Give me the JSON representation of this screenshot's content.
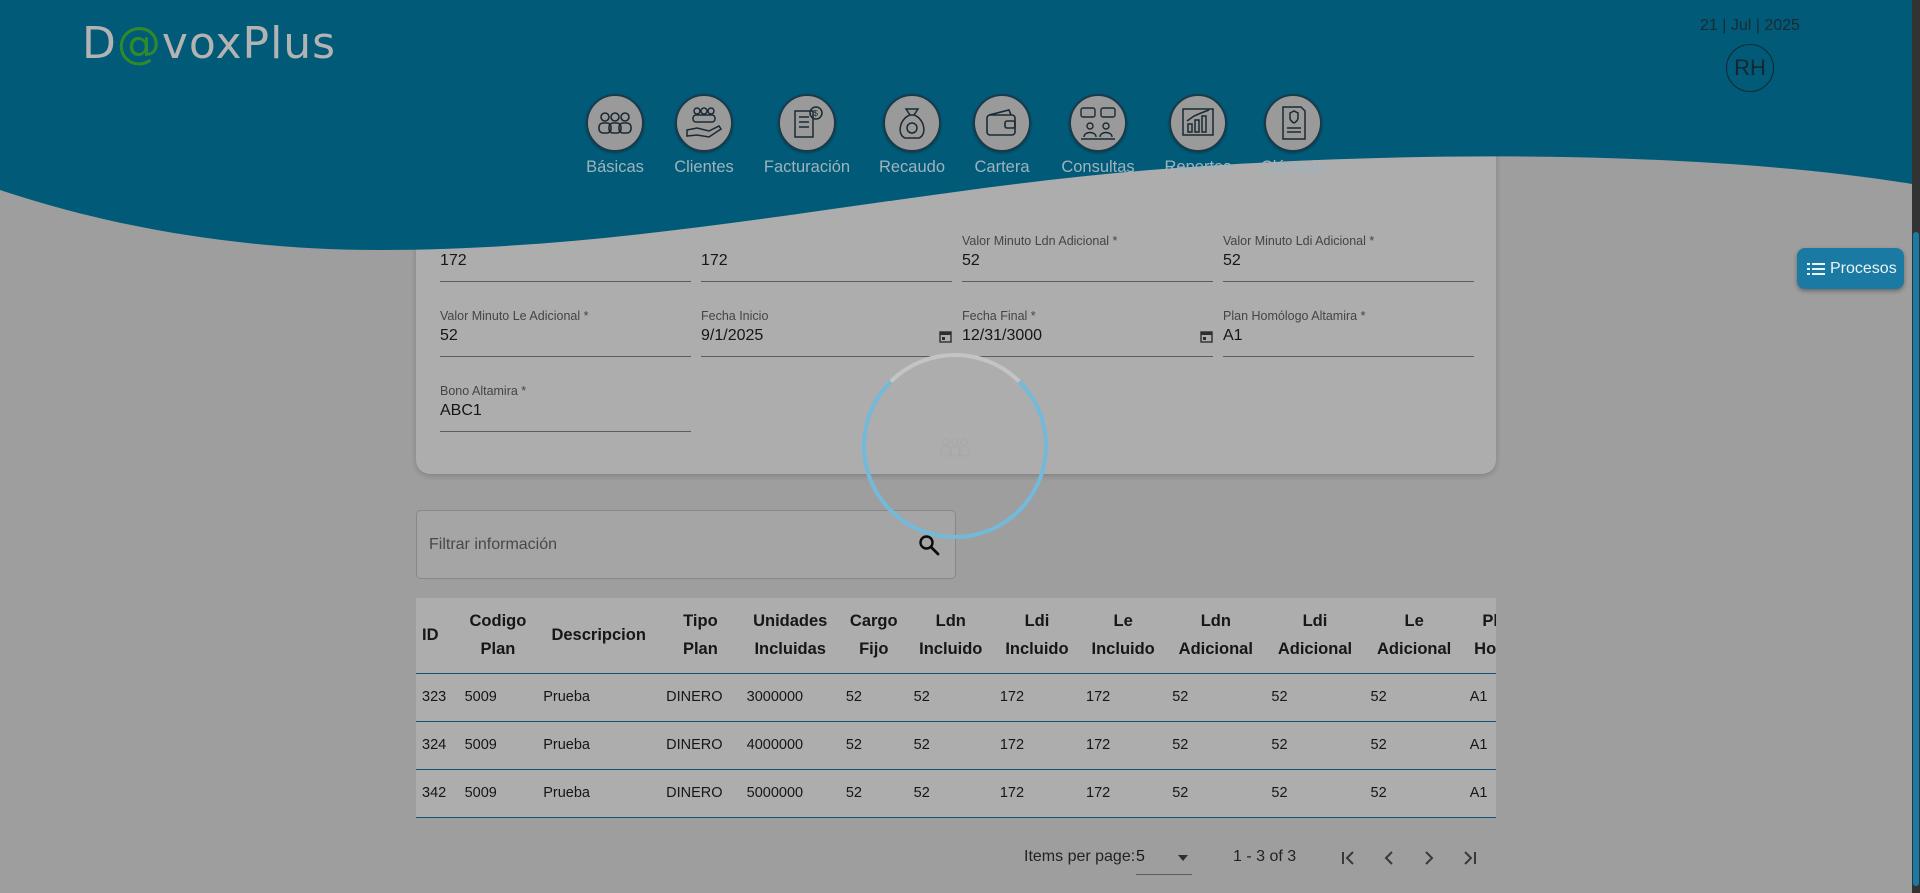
{
  "header": {
    "logo_prefix": "D",
    "logo_at": "@",
    "logo_suffix": "voxPlus",
    "date": "21 | Jul | 2025",
    "user_initials": "RH",
    "nav": [
      {
        "label": "Básicas",
        "icon": "group-icon"
      },
      {
        "label": "Clientes",
        "icon": "clients-hand-icon"
      },
      {
        "label": "Facturación",
        "icon": "invoice-icon"
      },
      {
        "label": "Recaudo",
        "icon": "money-bag-icon"
      },
      {
        "label": "Cartera",
        "icon": "wallet-icon"
      },
      {
        "label": "Consultas",
        "icon": "consult-icon"
      },
      {
        "label": "Reportes",
        "icon": "report-chart-icon"
      },
      {
        "label": "Cláusula",
        "icon": "contract-icon"
      }
    ],
    "procesos_label": "Procesos"
  },
  "form": {
    "row1": [
      {
        "label": "",
        "value": "172"
      },
      {
        "label": "",
        "value": "172"
      },
      {
        "label": "Valor Minuto Ldn Adicional *",
        "value": "52"
      },
      {
        "label": "Valor Minuto Ldi Adicional *",
        "value": "52"
      }
    ],
    "row2": [
      {
        "label": "Valor Minuto Le Adicional *",
        "value": "52"
      },
      {
        "label": "Fecha Inicio",
        "value": "9/1/2025"
      },
      {
        "label": "Fecha Final *",
        "value": "12/31/3000"
      },
      {
        "label": "Plan Homólogo Altamira *",
        "value": "A1"
      }
    ],
    "row3": [
      {
        "label": "Bono Altamira *",
        "value": "ABC1"
      }
    ]
  },
  "filter": {
    "placeholder": "Filtrar información"
  },
  "table": {
    "headers": [
      [
        "ID"
      ],
      [
        "Codigo",
        "Plan"
      ],
      [
        "Descripcion"
      ],
      [
        "Tipo",
        "Plan"
      ],
      [
        "Unidades",
        "Incluidas"
      ],
      [
        "Cargo",
        "Fijo"
      ],
      [
        "Ldn",
        "Incluido"
      ],
      [
        "Ldi",
        "Incluido"
      ],
      [
        "Le",
        "Incluido"
      ],
      [
        "Ldn",
        "Adicional"
      ],
      [
        "Ldi",
        "Adicional"
      ],
      [
        "Le",
        "Adicional"
      ],
      [
        "Plan",
        "Homol"
      ]
    ],
    "rows": [
      [
        "323",
        "5009",
        "Prueba",
        "DINERO",
        "3000000",
        "52",
        "52",
        "172",
        "172",
        "52",
        "52",
        "52",
        "A1"
      ],
      [
        "324",
        "5009",
        "Prueba",
        "DINERO",
        "4000000",
        "52",
        "52",
        "172",
        "172",
        "52",
        "52",
        "52",
        "A1"
      ],
      [
        "342",
        "5009",
        "Prueba",
        "DINERO",
        "5000000",
        "52",
        "52",
        "172",
        "172",
        "52",
        "52",
        "52",
        "A1"
      ]
    ]
  },
  "paginator": {
    "items_label": "Items per page:",
    "page_size": "5",
    "range": "1 - 3 of 3"
  },
  "colors": {
    "brand": "#005a78",
    "accent": "#1b7aa3",
    "spinner": "#73b9da"
  }
}
